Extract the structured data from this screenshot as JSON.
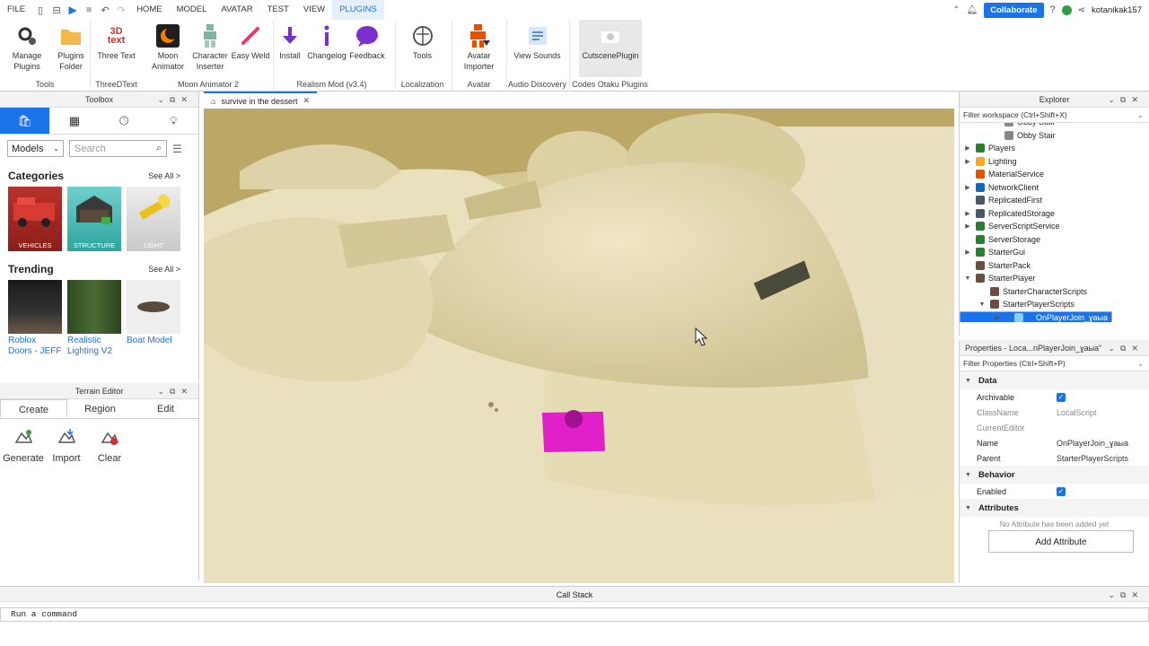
{
  "menubar": {
    "file": "FILE",
    "tabs": [
      "HOME",
      "MODEL",
      "AVATAR",
      "TEST",
      "VIEW",
      "PLUGINS"
    ],
    "active_tab": "PLUGINS",
    "collaborate": "Collaborate",
    "username": "kotanikak157"
  },
  "ribbon": {
    "groups": [
      {
        "label": "Tools",
        "buttons": [
          "Manage Plugins",
          "Plugins Folder"
        ]
      },
      {
        "label": "ThreeDText",
        "buttons": [
          "Three Text"
        ]
      },
      {
        "label": "Moon Animator 2",
        "buttons": [
          "Moon Animator",
          "Character Inserter",
          "Easy Weld"
        ]
      },
      {
        "label": "Realism Mod (v3.4)",
        "buttons": [
          "Install",
          "Changelog",
          "Feedback"
        ]
      },
      {
        "label": "Localization",
        "buttons": [
          "Tools"
        ]
      },
      {
        "label": "Avatar",
        "buttons": [
          "Avatar Importer"
        ]
      },
      {
        "label": "Audio Discovery",
        "buttons": [
          "View Sounds"
        ]
      },
      {
        "label": "Codes Otaku Plugins",
        "buttons": [
          "CutscenePlugin"
        ]
      }
    ]
  },
  "toolbox": {
    "title": "Toolbox",
    "dropdown": "Models",
    "search_placeholder": "Search",
    "categories_title": "Categories",
    "see_all": "See All >",
    "categories": [
      "VEHICLES",
      "STRUCTURE",
      "LIGHT"
    ],
    "trending_title": "Trending",
    "trending": [
      "Roblox Doors - JEFF",
      "Realistic Lighting V2",
      "Boat Model"
    ]
  },
  "terrain": {
    "title": "Terrain Editor",
    "tabs": [
      "Create",
      "Region",
      "Edit"
    ],
    "tools": [
      "Generate",
      "Import",
      "Clear"
    ]
  },
  "document_tab": "survive in the dessert",
  "explorer": {
    "title": "Explorer",
    "filter": "Filter workspace (Ctrl+Shift+X)",
    "items": [
      {
        "label": "Obby Stair",
        "indent": 2,
        "arrow": "",
        "color": "#888"
      },
      {
        "label": "Obby Stair",
        "indent": 2,
        "arrow": "",
        "color": "#888"
      },
      {
        "label": "Players",
        "indent": 0,
        "arrow": "▶",
        "color": "#2e7d32"
      },
      {
        "label": "Lighting",
        "indent": 0,
        "arrow": "▶",
        "color": "#f9a825"
      },
      {
        "label": "MaterialService",
        "indent": 0,
        "arrow": "",
        "color": "#e65100"
      },
      {
        "label": "NetworkClient",
        "indent": 0,
        "arrow": "▶",
        "color": "#1565c0"
      },
      {
        "label": "ReplicatedFirst",
        "indent": 0,
        "arrow": "",
        "color": "#455a64"
      },
      {
        "label": "ReplicatedStorage",
        "indent": 0,
        "arrow": "▶",
        "color": "#455a64"
      },
      {
        "label": "ServerScriptService",
        "indent": 0,
        "arrow": "▶",
        "color": "#2e7d32"
      },
      {
        "label": "ServerStorage",
        "indent": 0,
        "arrow": "",
        "color": "#2e7d32"
      },
      {
        "label": "StarterGui",
        "indent": 0,
        "arrow": "▶",
        "color": "#2e7d32"
      },
      {
        "label": "StarterPack",
        "indent": 0,
        "arrow": "",
        "color": "#6d4c41"
      },
      {
        "label": "StarterPlayer",
        "indent": 0,
        "arrow": "▼",
        "color": "#6d4c41"
      },
      {
        "label": "StarterCharacterScripts",
        "indent": 1,
        "arrow": "",
        "color": "#6d4c41"
      },
      {
        "label": "StarterPlayerScripts",
        "indent": 1,
        "arrow": "▼",
        "color": "#6d4c41"
      },
      {
        "label": "OnPlayerJoin_ɣaыa",
        "indent": 2,
        "arrow": "▶",
        "color": "#90caf9",
        "selected": true
      }
    ]
  },
  "properties": {
    "title": "Properties - Loca...nPlayerJoin_ɣaыa\"",
    "filter": "Filter Properties (Ctrl+Shift+P)",
    "data_cat": "Data",
    "archivable": "Archivable",
    "classname_k": "ClassName",
    "classname_v": "LocalScript",
    "currenteditor": "CurrentEditor",
    "name_k": "Name",
    "name_v": "OnPlayerJoin_ɣaыa",
    "parent_k": "Parent",
    "parent_v": "StarterPlayerScripts",
    "behavior_cat": "Behavior",
    "enabled": "Enabled",
    "attributes_cat": "Attributes",
    "no_attr": "No Attribute has been added yet",
    "add_attr": "Add Attribute"
  },
  "callstack": "Call Stack",
  "command_placeholder": "Run a command"
}
